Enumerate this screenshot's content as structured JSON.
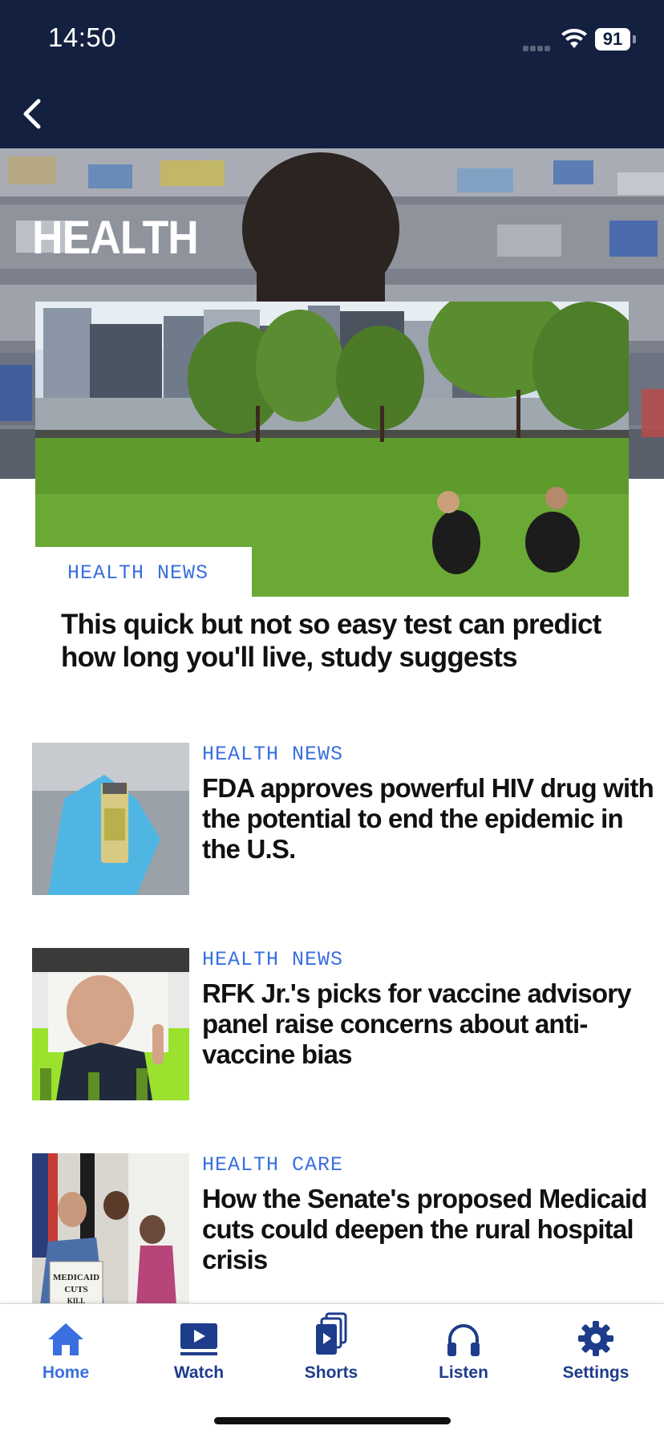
{
  "status_bar": {
    "time": "14:50",
    "battery": "91"
  },
  "page": {
    "title": "HEALTH"
  },
  "featured": {
    "tag": "HEALTH NEWS",
    "headline": "This quick but not so easy test can predict how long you'll live, study suggests"
  },
  "stories": [
    {
      "tag": "HEALTH NEWS",
      "headline": "FDA approves powerful HIV drug with the potential to end the epidemic in the U.S."
    },
    {
      "tag": "HEALTH NEWS",
      "headline": "RFK Jr.'s picks for vaccine advisory panel raise concerns about anti-vaccine bias"
    },
    {
      "tag": "HEALTH CARE",
      "headline": "How the Senate's proposed Medicaid cuts could deepen the rural hospital crisis"
    }
  ],
  "thumbnail_sign_text": "MEDICAID CUTS KILL",
  "tabs": [
    {
      "label": "Home",
      "icon": "home-icon",
      "active": true
    },
    {
      "label": "Watch",
      "icon": "watch-icon",
      "active": false
    },
    {
      "label": "Shorts",
      "icon": "shorts-icon",
      "active": false
    },
    {
      "label": "Listen",
      "icon": "headphones-icon",
      "active": false
    },
    {
      "label": "Settings",
      "icon": "gear-icon",
      "active": false
    }
  ],
  "colors": {
    "header_bg": "#13203f",
    "accent": "#3a6fe0",
    "tab_icon": "#1e3c8c"
  }
}
